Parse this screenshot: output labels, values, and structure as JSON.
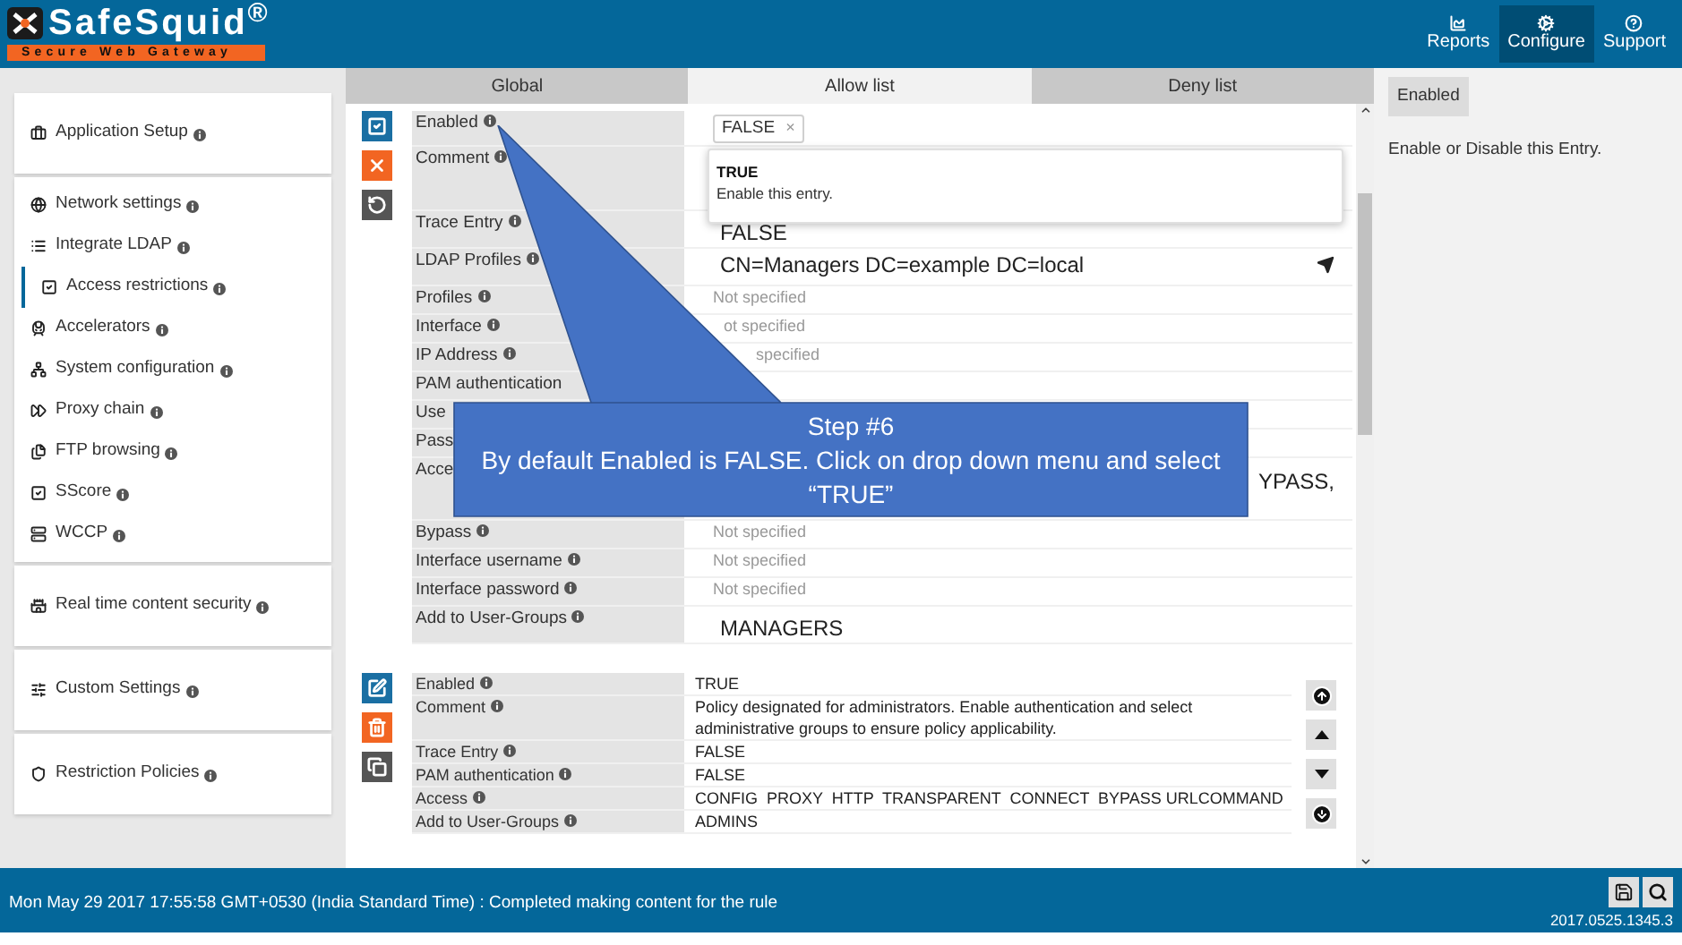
{
  "header": {
    "logo": {
      "name": "SafeSquid$^{®}$",
      "tagline": "Secure Web Gateway"
    },
    "nav": [
      {
        "label": "Reports",
        "kind": "reports",
        "selected": false
      },
      {
        "label": "Configure",
        "kind": "configure",
        "selected": true
      },
      {
        "label": "Support",
        "kind": "support",
        "selected": false
      }
    ]
  },
  "sidebar": {
    "groups": [
      {
        "items": [
          {
            "label": "Application Setup",
            "kind": "briefcase",
            "selected": false
          }
        ]
      },
      {
        "items": [
          {
            "label": "Network settings",
            "kind": "globe",
            "selected": false
          },
          {
            "label": "Integrate LDAP",
            "kind": "list",
            "selected": false
          },
          {
            "label": "Access restrictions",
            "kind": "check",
            "selected": true
          },
          {
            "label": "Accelerators",
            "kind": "train",
            "selected": false
          },
          {
            "label": "System configuration",
            "kind": "network",
            "selected": false
          },
          {
            "label": "Proxy chain",
            "kind": "forward",
            "selected": false
          },
          {
            "label": "FTP browsing",
            "kind": "files",
            "selected": false
          },
          {
            "label": "SScore",
            "kind": "check",
            "selected": false
          },
          {
            "label": "WCCP",
            "kind": "server",
            "selected": false
          }
        ]
      },
      {
        "items": [
          {
            "label": "Real time content security",
            "kind": "castle",
            "selected": false
          }
        ]
      },
      {
        "items": [
          {
            "label": "Custom Settings",
            "kind": "sliders",
            "selected": false
          }
        ]
      },
      {
        "items": [
          {
            "label": "Restriction Policies",
            "kind": "shield",
            "selected": false
          }
        ]
      }
    ]
  },
  "tabs": [
    {
      "label": "Global",
      "selected": false
    },
    {
      "label": "Allow list",
      "selected": true
    },
    {
      "label": "Deny list",
      "selected": false
    }
  ],
  "records": [
    {
      "kind": "editing",
      "actions": [
        {
          "kind": "save"
        },
        {
          "kind": "cancel"
        },
        {
          "kind": "undo"
        }
      ],
      "rows": [
        {
          "label": "Enabled",
          "info": true,
          "kind": "tag",
          "value": "FALSE",
          "remove": "×"
        },
        {
          "label": "Comment",
          "info": true,
          "kind": "area"
        },
        {
          "label": "Trace Entry",
          "info": true,
          "kind": "large",
          "value": "FALSE"
        },
        {
          "label": "LDAP Profiles",
          "info": true,
          "kind": "link",
          "value": "CN=Managers DC=example DC=local"
        },
        {
          "label": "Profiles",
          "info": true,
          "kind": "muted",
          "value": "Not specified"
        },
        {
          "label": "Interface",
          "info": true,
          "kind": "partial",
          "value": "ot specified"
        },
        {
          "label": "IP Address",
          "info": true,
          "kind": "fragment",
          "value": "specified"
        },
        {
          "label": "PAM authentication",
          "info": false,
          "kind": "muted"
        },
        {
          "label": "Use",
          "info": false,
          "kind": "muted"
        },
        {
          "label": "Pass",
          "info": false,
          "kind": "muted"
        },
        {
          "label": "Acce",
          "info": false,
          "kind": "tail",
          "value": "YPASS,"
        },
        {
          "label": "Bypass",
          "info": true,
          "kind": "muted",
          "value": "Not specified"
        },
        {
          "label": "Interface username",
          "info": true,
          "kind": "muted",
          "value": "Not specified"
        },
        {
          "label": "Interface password",
          "info": true,
          "kind": "muted",
          "value": "Not specified"
        },
        {
          "label": "Add to User-Groups",
          "info": true,
          "kind": "large",
          "value": "MANAGERS"
        }
      ]
    },
    {
      "kind": "saved",
      "actions": [
        {
          "kind": "edit"
        },
        {
          "kind": "delete"
        },
        {
          "kind": "copy"
        }
      ],
      "rows": [
        {
          "label": "Enabled",
          "info": true,
          "kind": "plain",
          "value": "TRUE"
        },
        {
          "label": "Comment",
          "info": true,
          "kind": "plain",
          "value": "Policy designated for administrators. Enable authentication and select administrative groups to ensure policy applicability."
        },
        {
          "label": "Trace Entry",
          "info": true,
          "kind": "plain",
          "value": "FALSE"
        },
        {
          "label": "PAM authentication",
          "info": true,
          "kind": "plain",
          "value": "FALSE"
        },
        {
          "label": "Access",
          "info": true,
          "kind": "plain",
          "value": "CONFIG  PROXY  HTTP  TRANSPARENT  CONNECT  BYPASS URLCOMMAND"
        },
        {
          "label": "Add to User-Groups",
          "info": true,
          "kind": "plain",
          "value": "ADMINS"
        }
      ]
    }
  ],
  "dropdown": {
    "options": [
      {
        "title": "TRUE",
        "description": "Enable this entry."
      }
    ]
  },
  "callout": {
    "title": "Step #6",
    "text": "By default Enabled is FALSE. Click on drop down menu and select “TRUE”"
  },
  "help": {
    "title": "Enabled",
    "text": "Enable or Disable this Entry."
  },
  "status_bar": {
    "message": "Mon May 29 2017 17:55:58 GMT+0530 (India Standard Time) : Completed making content for the rule",
    "version": "2017.0525.1345.3"
  }
}
